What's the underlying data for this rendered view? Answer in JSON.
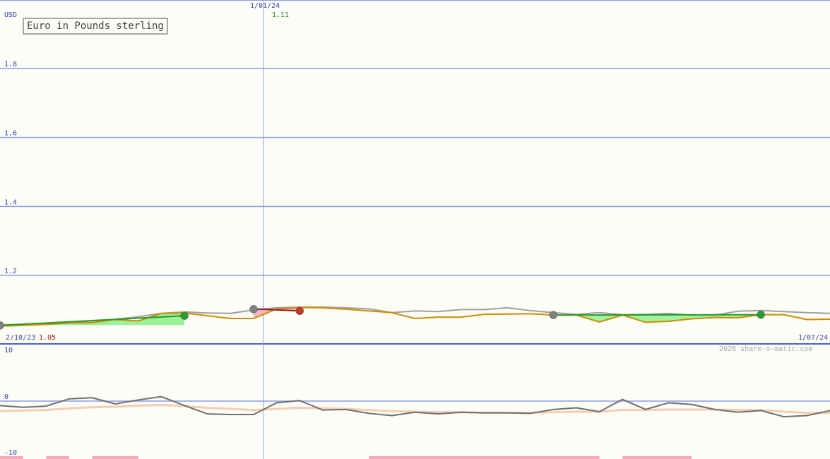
{
  "chart_data": {
    "type": "line",
    "title": "Euro in Pounds sterling",
    "currency_label": "USD",
    "date_start": "2/10/23",
    "date_end": "1/07/24",
    "marker_date": "1/01/24",
    "start_value": "1.05",
    "marker_value": "1.11",
    "copyright": "2026 share-o-matic.com",
    "main_panel": {
      "ylim": [
        1.0,
        1.98
      ],
      "y_ticks": [
        {
          "value": 1.8,
          "label": "1.8"
        },
        {
          "value": 1.6,
          "label": "1.6"
        },
        {
          "value": 1.4,
          "label": "1.4"
        },
        {
          "value": 1.2,
          "label": "1.2"
        }
      ],
      "x_count": 34,
      "price": [
        1.053,
        1.055,
        1.058,
        1.062,
        1.063,
        1.072,
        1.068,
        1.09,
        1.091,
        1.083,
        1.075,
        1.075,
        1.103,
        1.107,
        1.106,
        1.102,
        1.097,
        1.092,
        1.075,
        1.079,
        1.079,
        1.087,
        1.088,
        1.089,
        1.085,
        1.085,
        1.065,
        1.085,
        1.064,
        1.067,
        1.074,
        1.078,
        1.077,
        1.086,
        1.086,
        1.072,
        1.073
      ],
      "moving_avg": [
        1.056,
        1.058,
        1.061,
        1.063,
        1.068,
        1.073,
        1.08,
        1.09,
        1.094,
        1.091,
        1.09,
        1.1,
        1.106,
        1.108,
        1.108,
        1.106,
        1.103,
        1.092,
        1.097,
        1.095,
        1.101,
        1.101,
        1.106,
        1.098,
        1.092,
        1.087,
        1.092,
        1.086,
        1.087,
        1.09,
        1.085,
        1.085,
        1.096,
        1.098,
        1.095,
        1.092,
        1.09
      ],
      "signals": [
        {
          "index": 0,
          "value": 1.055,
          "kind": "neutral"
        },
        {
          "index": 8,
          "value": 1.083,
          "kind": "buy"
        },
        {
          "index": 11,
          "value": 1.102,
          "kind": "neutral"
        },
        {
          "index": 13,
          "value": 1.097,
          "kind": "sell"
        },
        {
          "index": 24,
          "value": 1.085,
          "kind": "neutral"
        },
        {
          "index": 33,
          "value": 1.086,
          "kind": "buy"
        }
      ],
      "trend_segments": [
        {
          "from": 0,
          "to": 8,
          "from_value": 1.055,
          "to_value": 1.083,
          "kind": "buy"
        },
        {
          "from": 11,
          "to": 13,
          "from_value": 1.103,
          "to_value": 1.097,
          "kind": "sell"
        },
        {
          "from": 24,
          "to": 33,
          "from_value": 1.085,
          "to_value": 1.086,
          "kind": "buy"
        }
      ]
    },
    "indicator_panel": {
      "ylim": [
        -10,
        10
      ],
      "y_ticks": [
        {
          "value": 10,
          "label": "10"
        },
        {
          "value": 0,
          "label": "0"
        },
        {
          "value": -10,
          "label": "-10"
        }
      ],
      "oscillator": [
        -0.8,
        -1.1,
        -0.9,
        0.4,
        0.6,
        -0.5,
        0.2,
        0.8,
        -0.8,
        -2.3,
        -2.4,
        -2.4,
        -0.3,
        0.1,
        -1.6,
        -1.5,
        -2.2,
        -2.6,
        -2.0,
        -2.3,
        -2.0,
        -2.1,
        -2.1,
        -2.2,
        -1.5,
        -1.2,
        -1.9,
        0.3,
        -1.5,
        -0.3,
        -0.6,
        -1.5,
        -2.0,
        -1.7,
        -2.8,
        -2.6,
        -1.7
      ],
      "signal_line": [
        -1.8,
        -1.7,
        -1.6,
        -1.3,
        -1.1,
        -1.0,
        -0.8,
        -0.7,
        -0.9,
        -1.2,
        -1.4,
        -1.6,
        -1.4,
        -1.2,
        -1.3,
        -1.4,
        -1.6,
        -1.8,
        -1.9,
        -2.0,
        -2.0,
        -2.1,
        -2.1,
        -2.1,
        -2.0,
        -1.9,
        -1.9,
        -1.6,
        -1.6,
        -1.5,
        -1.5,
        -1.5,
        -1.6,
        -1.6,
        -1.9,
        -2.1,
        -2.1
      ],
      "histogram_blocks": [
        {
          "from": 0,
          "to": 1,
          "kind": "sell"
        },
        {
          "from": 2,
          "to": 3,
          "kind": "sell"
        },
        {
          "from": 4,
          "to": 6,
          "kind": "sell"
        },
        {
          "from": 16,
          "to": 21,
          "kind": "sell"
        },
        {
          "from": 21,
          "to": 26,
          "kind": "sell"
        },
        {
          "from": 27,
          "to": 30,
          "kind": "sell"
        },
        {
          "from": 36,
          "to": 38,
          "kind": "buy"
        }
      ]
    },
    "colors": {
      "price_line": "#d08a00",
      "moving_avg": "#a0a0a0",
      "grid": "#8c9ce8",
      "buy": "#2a9a2a",
      "sell": "#c0392b",
      "neutral": "#808080",
      "buy_fill": "#90ee90",
      "sell_fill": "#f5aabb",
      "axis_text": "#3344aa"
    }
  }
}
